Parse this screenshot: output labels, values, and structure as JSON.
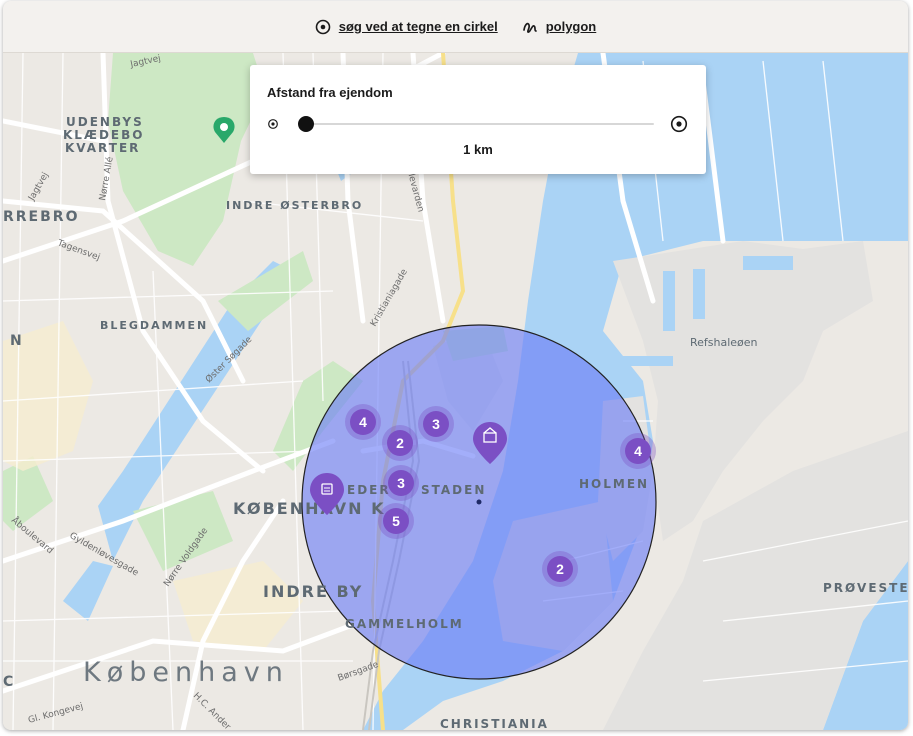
{
  "toolbar": {
    "circle_label": "søg ved at tegne en cirkel",
    "polygon_label": "polygon"
  },
  "distance_panel": {
    "title": "Afstand fra ejendom",
    "value_label": "1 km",
    "slider_fraction": 0.0
  },
  "map": {
    "labels": {
      "udenbys": "UDENBYS",
      "klaedebo": "KLÆDEBO",
      "kvarter": "KVARTER",
      "rrebro": "RREBRO",
      "indre_osterbro": "INDRE ØSTERBRO",
      "blegdammen": "BLEGDAMMEN",
      "n": "N",
      "refshaleoen": "Refshaleøen",
      "frederiksstaden_a": "EDER",
      "frederiksstaden_b": "STADEN",
      "holmen": "HOLMEN",
      "kobenhavn_k": "KØBENHAVN K",
      "indre_by": "INDRE BY",
      "gammelholm": "GAMMELHOLM",
      "proveste": "PRØVESTE",
      "kobenhavn": "København",
      "christiania": "CHRISTIANIA",
      "c": "C"
    },
    "streets": {
      "jagtvej_top": "Jagtvej",
      "jagtvej_left": "Jagtvej",
      "norre_alle": "Nørre Allé",
      "tagensvej": "Tagensvej",
      "oster_sogade": "Øster Søgade",
      "kristianiagade": "Kristianiagade",
      "boulevard": "ulevarden",
      "abouleverd": "Åboulevard",
      "gyldenlovesgade": "Gyldenløvesgade",
      "norre_voldgade": "Nørre Voldgade",
      "gl_kongevej": "Gl. Kongevej",
      "hc_andersen": "H.C. Ander",
      "borsgade": "Børsgade"
    },
    "clusters": [
      {
        "id": "c1",
        "count": "4"
      },
      {
        "id": "c2",
        "count": "3"
      },
      {
        "id": "c3",
        "count": "2"
      },
      {
        "id": "c4",
        "count": "3"
      },
      {
        "id": "c5",
        "count": "5"
      },
      {
        "id": "c6",
        "count": "4"
      },
      {
        "id": "c7",
        "count": "2"
      }
    ],
    "colors": {
      "cluster": "#7b4fc4",
      "circle_fill": "#6b7cf7",
      "water": "#aad3f5",
      "park": "#cde8c4"
    }
  }
}
